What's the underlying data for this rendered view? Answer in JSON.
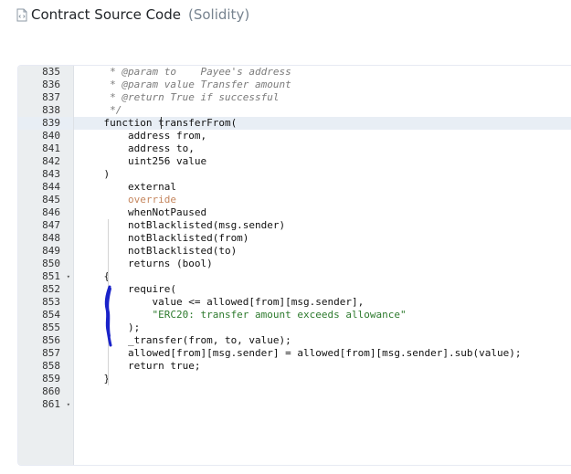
{
  "header": {
    "title": "Contract Source Code",
    "language": "(Solidity)"
  },
  "code": {
    "lines": [
      {
        "num": "835",
        "text": "     * @param to    Payee's address",
        "style": "comment"
      },
      {
        "num": "836",
        "text": "     * @param value Transfer amount",
        "style": "comment"
      },
      {
        "num": "837",
        "text": "     * @return True if successful",
        "style": "comment"
      },
      {
        "num": "838",
        "text": "     */",
        "style": "comment"
      },
      {
        "num": "839",
        "text": "    function transferFrom(",
        "style": "plain"
      },
      {
        "num": "840",
        "text": "        address from,",
        "style": "plain"
      },
      {
        "num": "841",
        "text": "        address to,",
        "style": "plain"
      },
      {
        "num": "842",
        "text": "        uint256 value",
        "style": "plain"
      },
      {
        "num": "843",
        "text": "    )",
        "style": "plain"
      },
      {
        "num": "844",
        "text": "        external",
        "style": "plain"
      },
      {
        "num": "845",
        "text": "        override",
        "style": "mod"
      },
      {
        "num": "846",
        "text": "        whenNotPaused",
        "style": "plain"
      },
      {
        "num": "847",
        "text": "        notBlacklisted(msg.sender)",
        "style": "plain"
      },
      {
        "num": "848",
        "text": "        notBlacklisted(from)",
        "style": "plain"
      },
      {
        "num": "849",
        "text": "        notBlacklisted(to)",
        "style": "plain"
      },
      {
        "num": "850",
        "text": "        returns (bool)",
        "style": "plain"
      },
      {
        "num": "851",
        "text": "    {",
        "style": "plain"
      },
      {
        "num": "852",
        "text": "        require(",
        "style": "plain"
      },
      {
        "num": "853",
        "text": "            value <= allowed[from][msg.sender],",
        "style": "plain"
      },
      {
        "num": "854",
        "text": "            \"ERC20: transfer amount exceeds allowance\"",
        "style": "str"
      },
      {
        "num": "855",
        "text": "        );",
        "style": "plain"
      },
      {
        "num": "856",
        "text": "        _transfer(from, to, value);",
        "style": "plain"
      },
      {
        "num": "857",
        "text": "        allowed[from][msg.sender] = allowed[from][msg.sender].sub(value);",
        "style": "plain"
      },
      {
        "num": "858",
        "text": "        return true;",
        "style": "plain"
      },
      {
        "num": "859",
        "text": "    }",
        "style": "plain"
      },
      {
        "num": "860",
        "text": "",
        "style": "plain"
      },
      {
        "num": "861",
        "text": "",
        "style": "plain"
      }
    ],
    "folded_lines": [
      "851",
      "861"
    ],
    "highlighted_line": "839"
  },
  "colors": {
    "gutter_bg": "#ebeef0",
    "highlight": "#e8eef5",
    "scribble": "#1a23c9"
  }
}
